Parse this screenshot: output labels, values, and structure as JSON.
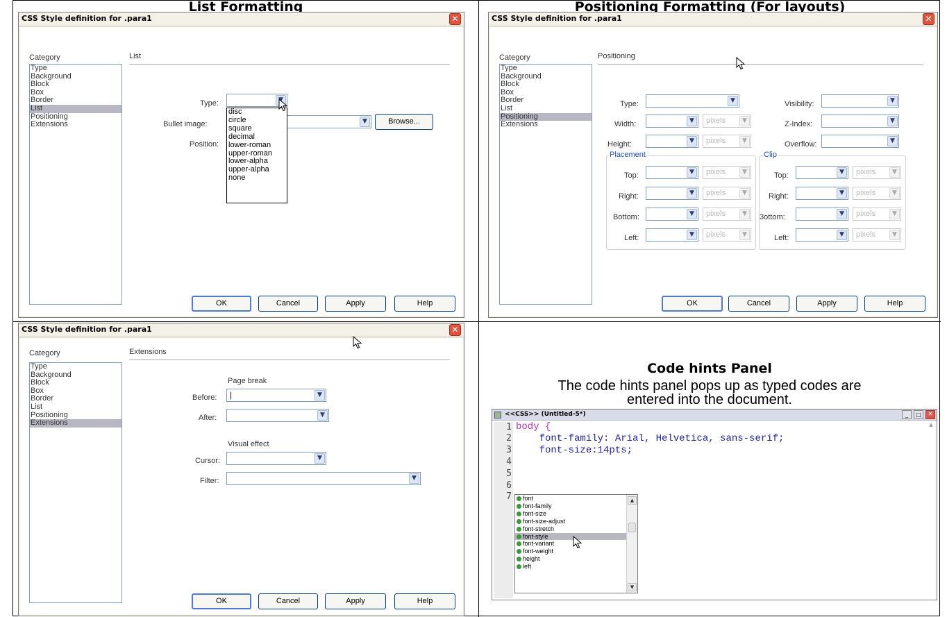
{
  "cells": {
    "list_title": "List Formatting",
    "pos_title": "Positioning Formatting (For layouts)"
  },
  "dialog_title": "CSS Style definition for .para1",
  "category_label": "Category",
  "categories": [
    "Type",
    "Background",
    "Block",
    "Box",
    "Border",
    "List",
    "Positioning",
    "Extensions"
  ],
  "buttons": {
    "ok": "OK",
    "cancel": "Cancel",
    "apply": "Apply",
    "help": "Help",
    "browse": "Browse..."
  },
  "list_dialog": {
    "section": "List",
    "selected_category": "List",
    "type_label": "Type:",
    "bullet_label": "Bullet image:",
    "position_label": "Position:",
    "type_options": [
      "disc",
      "circle",
      "square",
      "decimal",
      "lower-roman",
      "upper-roman",
      "lower-alpha",
      "upper-alpha",
      "none"
    ]
  },
  "pos_dialog": {
    "section": "Positioning",
    "selected_category": "Positioning",
    "type_label": "Type:",
    "width_label": "Width:",
    "height_label": "Height:",
    "visibility_label": "Visibility:",
    "zindex_label": "Z-Index:",
    "overflow_label": "Overflow:",
    "placement_label": "Placement",
    "clip_label": "Clip",
    "top_label": "Top:",
    "right_label": "Right:",
    "bottom_label": "Bottom:",
    "bottom_label_clip": "3ottom:",
    "left_label": "Left:",
    "unit": "pixels"
  },
  "ext_dialog": {
    "section": "Extensions",
    "selected_category": "Extensions",
    "page_break": "Page break",
    "before_label": "Before:",
    "before_value": "|",
    "after_label": "After:",
    "visual_effect": "Visual effect",
    "cursor_label": "Cursor:",
    "filter_label": "Filter:"
  },
  "code_panel": {
    "heading": "Code hints Panel",
    "desc_line1": "The code hints panel pops up as typed codes are",
    "desc_line2": "entered into the document.",
    "window_title": "<<CSS>> (Untitled-5*)",
    "line_numbers": [
      "1",
      "2",
      "3",
      "4",
      "5",
      "6",
      "7"
    ],
    "code_line1": "body {",
    "code_line2": "    font-family: Arial, Helvetica, sans-serif;",
    "code_line3": "    font-size:14pts;",
    "hints": [
      "font",
      "font-family",
      "font-size",
      "font-size-adjust",
      "font-stretch",
      "font-style",
      "font-variant",
      "font-weight",
      "height",
      "left"
    ],
    "highlighted_hint": "font-style"
  },
  "colors": {
    "selected_category": "#b8b8c4",
    "code_keyword": "#c030c0",
    "code_value": "#2020a0",
    "group_label": "#2050c8",
    "close_button": "#e0553d"
  }
}
